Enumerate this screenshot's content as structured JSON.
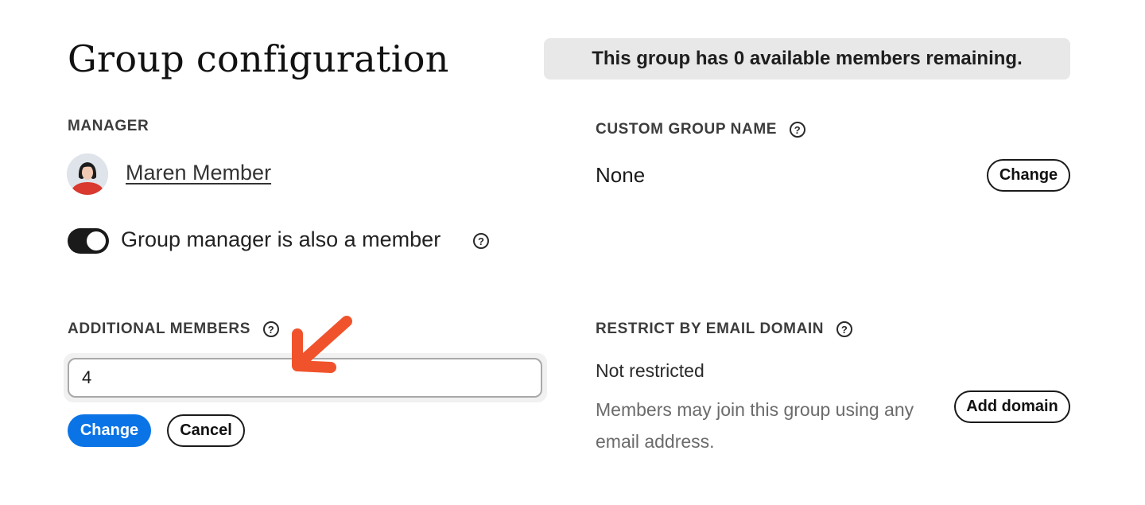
{
  "page": {
    "title": "Group configuration",
    "banner": "This group has 0 available members remaining."
  },
  "manager": {
    "label": "MANAGER",
    "name": "Maren Member",
    "also_member_label": "Group manager is also a member",
    "also_member_on": true
  },
  "custom_group_name": {
    "label": "CUSTOM GROUP NAME",
    "value": "None",
    "change_label": "Change"
  },
  "additional_members": {
    "label": "ADDITIONAL MEMBERS",
    "value": "4",
    "change_label": "Change",
    "cancel_label": "Cancel"
  },
  "restrict_domain": {
    "label": "RESTRICT BY EMAIL DOMAIN",
    "status": "Not restricted",
    "description": "Members may join this group using any email address.",
    "add_label": "Add domain"
  },
  "colors": {
    "primary": "#0a74e6",
    "annotation_arrow": "#f0532c",
    "banner_bg": "#e8e8e8"
  }
}
